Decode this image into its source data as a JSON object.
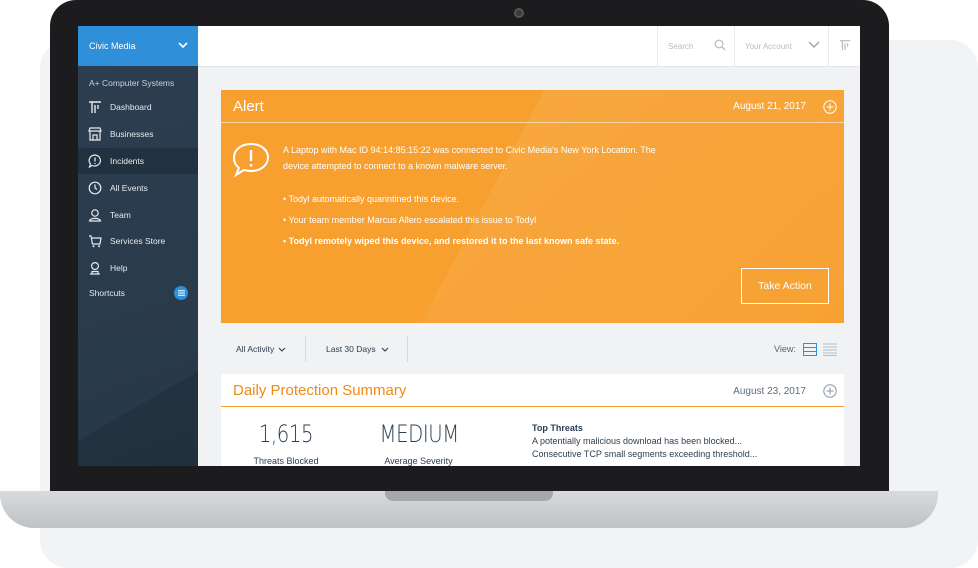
{
  "sidebar": {
    "org": "Civic Media",
    "company": "A+ Computer Systems",
    "items": [
      {
        "label": "Dashboard",
        "icon": "brand-t-icon"
      },
      {
        "label": "Businesses",
        "icon": "storefront-icon"
      },
      {
        "label": "Incidents",
        "icon": "alert-bubble-icon",
        "active": true
      },
      {
        "label": "All Events",
        "icon": "clock-icon"
      },
      {
        "label": "Team",
        "icon": "user-icon"
      },
      {
        "label": "Services Store",
        "icon": "cart-icon"
      },
      {
        "label": "Help",
        "icon": "help-user-icon"
      }
    ],
    "shortcuts": "Shortcuts"
  },
  "topbar": {
    "search_placeholder": "Search",
    "account_label": "Your Account"
  },
  "alert": {
    "title": "Alert",
    "date": "August 21, 2017",
    "message_line1": "A Laptop with Mac ID 94:14:85:15:22 was connected to Civic Media's New York Location. The",
    "message_line2": "device attempted to connect to a known malware server.",
    "events": [
      "• Todyl automatically quarintined this device.",
      "• Your team member Marcus Allero escalated this issue to Todyl",
      "• Todyl remotely wiped this device, and restored it to the last known safe state."
    ],
    "action_label": "Take Action"
  },
  "filters": {
    "activity": "All Activity",
    "range": "Last 30 Days",
    "view_label": "View:"
  },
  "summary": {
    "title": "Daily Protection Summary",
    "date": "August 23, 2017",
    "threats_blocked_value": "1,615",
    "threats_blocked_label": "Threats Blocked",
    "severity_value": "MEDIUM",
    "severity_label": "Average Severity",
    "top_threats_heading": "Top Threats",
    "top_threats": [
      "A potentially malicious download has been blocked...",
      "Consecutive TCP small segments exceeding threshold..."
    ]
  },
  "colors": {
    "accent_blue": "#2f8fd8",
    "alert_orange": "#f7a030",
    "sidebar_navy": "#2c3e50"
  }
}
